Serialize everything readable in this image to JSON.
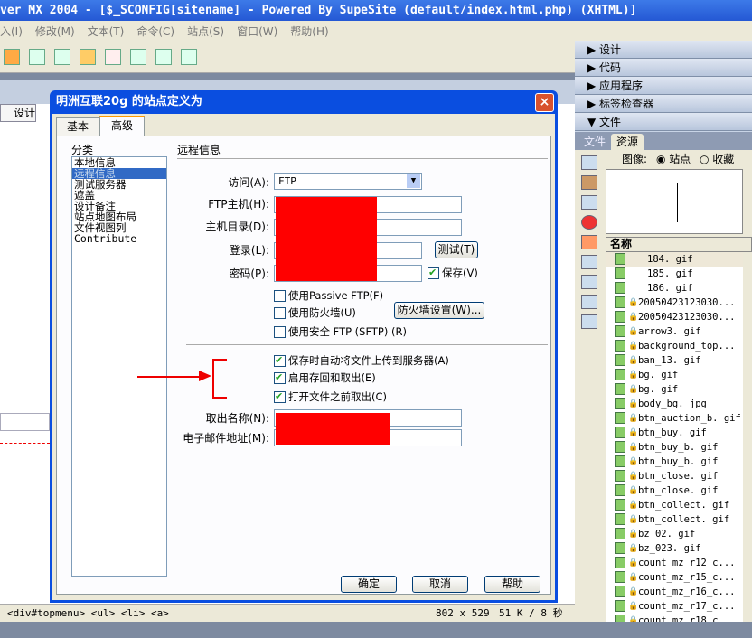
{
  "app": {
    "title": "ver MX 2004 - [$_SCONFIG[sitename] - Powered By SupeSite (default/index.html.php) (XHTML)]"
  },
  "menu": [
    "入(I)",
    "修改(M)",
    "文本(T)",
    "命令(C)",
    "站点(S)",
    "窗口(W)",
    "帮助(H)"
  ],
  "document": {
    "design_tab": "设计",
    "statusbar": {
      "tag_path": "<div#topmenu> <ul> <li> <a>",
      "dimensions": "802 x 529",
      "size_time": "51 K / 8 秒"
    }
  },
  "panels": {
    "groups": [
      {
        "label": "设计",
        "expanded": false
      },
      {
        "label": "代码",
        "expanded": false
      },
      {
        "label": "应用程序",
        "expanded": false
      },
      {
        "label": "标签检查器",
        "expanded": false
      },
      {
        "label": "文件",
        "expanded": true
      }
    ],
    "file_tabs": [
      "文件",
      "资源"
    ],
    "active_tab": "资源",
    "assets": {
      "label": "图像:",
      "radio_site": "站点",
      "radio_favorites": "收藏",
      "selected": "站点",
      "column_name": "名称",
      "files": [
        {
          "name": "184. gif",
          "locked": false
        },
        {
          "name": "185. gif",
          "locked": false
        },
        {
          "name": "186. gif",
          "locked": false
        },
        {
          "name": "20050423123030...",
          "locked": true
        },
        {
          "name": "20050423123030...",
          "locked": true
        },
        {
          "name": "arrow3. gif",
          "locked": true
        },
        {
          "name": "background_top...",
          "locked": true
        },
        {
          "name": "ban_13. gif",
          "locked": true
        },
        {
          "name": "bg. gif",
          "locked": true
        },
        {
          "name": "bg. gif",
          "locked": true
        },
        {
          "name": "body_bg. jpg",
          "locked": true
        },
        {
          "name": "btn_auction_b. gif",
          "locked": true
        },
        {
          "name": "btn_buy. gif",
          "locked": true
        },
        {
          "name": "btn_buy_b. gif",
          "locked": true
        },
        {
          "name": "btn_buy_b. gif",
          "locked": true
        },
        {
          "name": "btn_close. gif",
          "locked": true
        },
        {
          "name": "btn_close. gif",
          "locked": true
        },
        {
          "name": "btn_collect. gif",
          "locked": true
        },
        {
          "name": "btn_collect. gif",
          "locked": true
        },
        {
          "name": "bz_02. gif",
          "locked": true
        },
        {
          "name": "bz_023. gif",
          "locked": true
        },
        {
          "name": "count_mz_r12_c...",
          "locked": true
        },
        {
          "name": "count_mz_r15_c...",
          "locked": true
        },
        {
          "name": "count_mz_r16_c...",
          "locked": true
        },
        {
          "name": "count_mz_r17_c...",
          "locked": true
        },
        {
          "name": "count_mz_r18_c...",
          "locked": true
        }
      ]
    }
  },
  "dialog": {
    "title": "明洲互联20g 的站点定义为",
    "close": "×",
    "tabs": [
      "基本",
      "高级"
    ],
    "active_tab": "高级",
    "category_label": "分类",
    "categories": [
      "本地信息",
      "远程信息",
      "测试服务器",
      "遮盖",
      "设计备注",
      "站点地图布局",
      "文件视图列",
      "Contribute"
    ],
    "selected_category": "远程信息",
    "section_title": "远程信息",
    "access_label": "访问(A):",
    "access_value": "FTP",
    "ftp_host_label": "FTP主机(H):",
    "host_dir_label": "主机目录(D):",
    "login_label": "登录(L):",
    "password_label": "密码(P):",
    "test_button": "测试(T)",
    "save_label": "保存(V)",
    "save_checked": true,
    "passive": {
      "label": "使用Passive FTP(F)",
      "checked": false
    },
    "firewall": {
      "label": "使用防火墙(U)",
      "checked": false
    },
    "firewall_settings_button": "防火墙设置(W)...",
    "sftp": {
      "label": "使用安全 FTP (SFTP) (R)",
      "checked": false
    },
    "auto_upload": {
      "label": "保存时自动将文件上传到服务器(A)",
      "checked": true
    },
    "checkin_out": {
      "label": "启用存回和取出(E)",
      "checked": true
    },
    "checkout_on_open": {
      "label": "打开文件之前取出(C)",
      "checked": true
    },
    "checkout_name_label": "取出名称(N):",
    "email_label": "电子邮件地址(M):",
    "ok": "确定",
    "cancel": "取消",
    "help": "帮助"
  },
  "colors": {
    "title_blue": "#2458d4",
    "redaction": "#ff0000",
    "annotation": "#e00000"
  }
}
